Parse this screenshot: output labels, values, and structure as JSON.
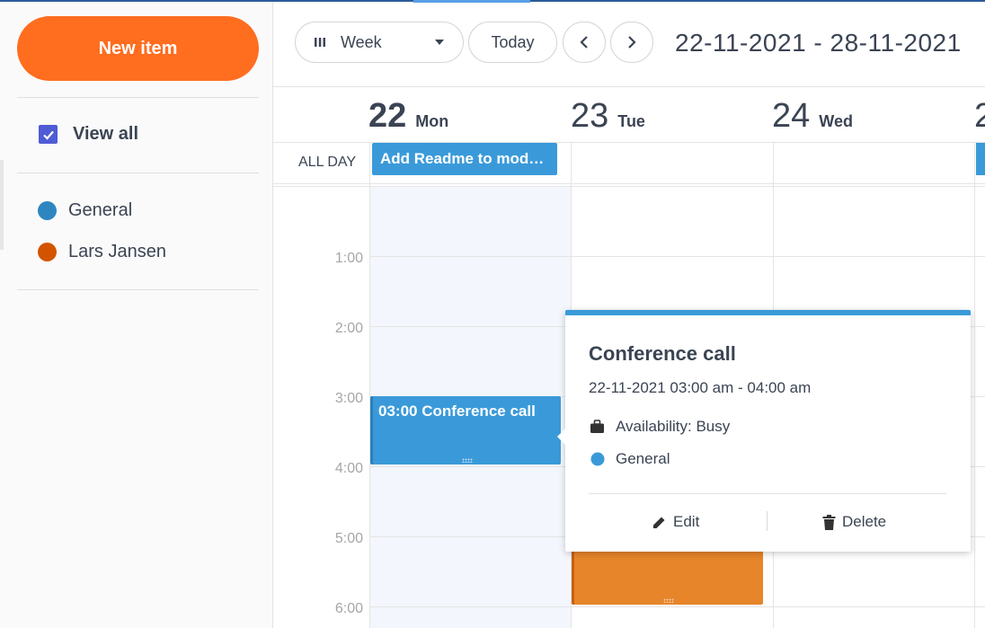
{
  "sidebar": {
    "new_item_label": "New item",
    "view_all_label": "View all",
    "calendars": [
      {
        "label": "General",
        "color": "#2e86c1"
      },
      {
        "label": "Lars Jansen",
        "color": "#d35400"
      }
    ]
  },
  "toolbar": {
    "view_select": "Week",
    "today_label": "Today",
    "prev_icon": "chevron-left-icon",
    "next_icon": "chevron-right-icon",
    "date_range": "22-11-2021 - 28-11-2021"
  },
  "days": [
    {
      "num": "22",
      "name": "Mon"
    },
    {
      "num": "23",
      "name": "Tue"
    },
    {
      "num": "24",
      "name": "Wed"
    },
    {
      "num": "2"
    }
  ],
  "grid": {
    "allday_label": "ALL DAY",
    "hours": [
      "1:00",
      "2:00",
      "3:00",
      "4:00",
      "5:00",
      "6:00"
    ]
  },
  "events": {
    "allday_title": "Add Readme to mod…",
    "conf_title": "03:00 Conference call"
  },
  "popup": {
    "title": "Conference call",
    "time": "22-11-2021 03:00 am - 04:00 am",
    "availability": "Availability: Busy",
    "calendar": "General",
    "edit_label": "Edit",
    "delete_label": "Delete"
  },
  "colors": {
    "accent_orange": "#ff6d1f",
    "event_blue": "#3a9ad9",
    "event_orange": "#e6852a",
    "checkbox": "#4f5bd5"
  }
}
